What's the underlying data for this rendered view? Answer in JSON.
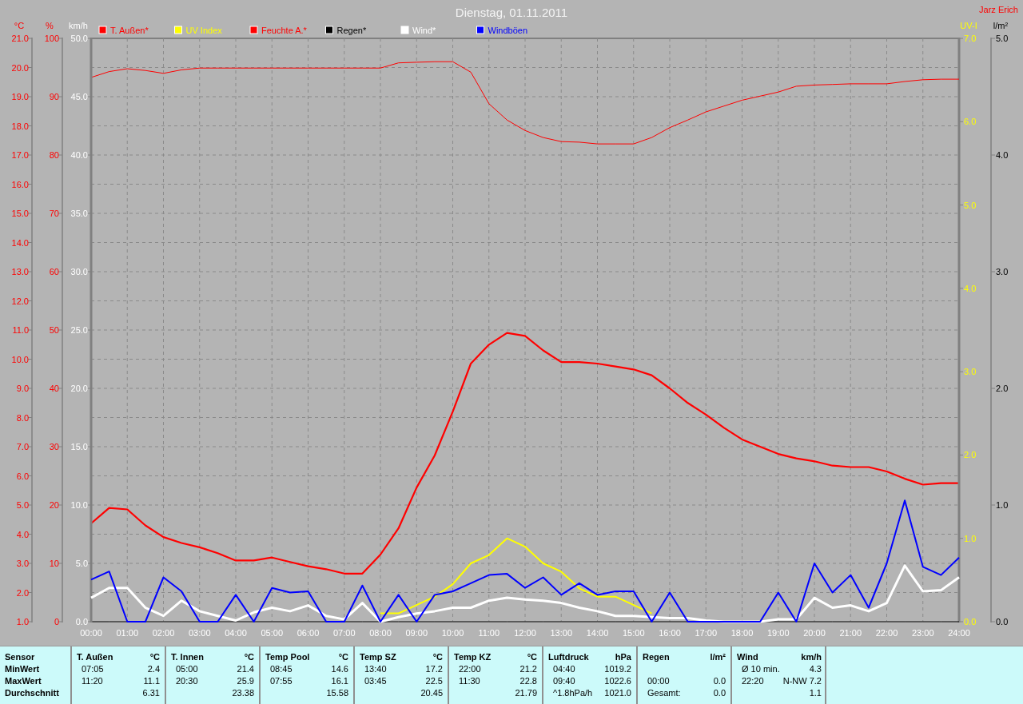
{
  "chart": {
    "title": "Dienstag, 01.11.2011",
    "author": "Jarz Erich",
    "layers": [
      {
        "chart_data": {
          "type": "line",
          "ylabel": "°C",
          "xlim": [
            0,
            24
          ],
          "ylim": [
            1,
            21
          ],
          "yticks": [
            {
              "value": 21,
              "label": "21.0"
            },
            {
              "value": 20,
              "label": "20.0"
            },
            {
              "value": 19,
              "label": "19.0"
            },
            {
              "value": 18,
              "label": "18.0"
            },
            {
              "value": 17,
              "label": "17.0"
            },
            {
              "value": 16,
              "label": "16.0"
            },
            {
              "value": 15,
              "label": "15.0"
            },
            {
              "value": 14,
              "label": "14.0"
            },
            {
              "value": 13,
              "label": "13.0"
            },
            {
              "value": 12,
              "label": "12.0"
            },
            {
              "value": 11,
              "label": "11.0"
            },
            {
              "value": 10,
              "label": "10.0"
            },
            {
              "value": 9,
              "label": "9.0"
            },
            {
              "value": 8,
              "label": "8.0"
            },
            {
              "value": 7,
              "label": "7.0"
            },
            {
              "value": 6,
              "label": "6.0"
            },
            {
              "value": 5,
              "label": "5.0"
            },
            {
              "value": 4,
              "label": "4.0"
            },
            {
              "value": 3,
              "label": "3.0"
            },
            {
              "value": 2,
              "label": "2.0"
            },
            {
              "value": 1,
              "label": "1.0"
            }
          ],
          "x": [
            0,
            0.5,
            1,
            1.5,
            2,
            2.5,
            3,
            3.5,
            4,
            4.5,
            5,
            5.5,
            6,
            6.5,
            7,
            7.5,
            8,
            8.5,
            9,
            9.5,
            10,
            10.5,
            11,
            11.5,
            12,
            12.5,
            13,
            13.5,
            14,
            14.5,
            15,
            15.5,
            16,
            16.5,
            17,
            17.5,
            18,
            18.5,
            19,
            19.5,
            20,
            20.5,
            21,
            21.5,
            22,
            22.5,
            23,
            23.5,
            24
          ],
          "series": [
            {
              "name": "T. Außen*",
              "color": "#ff0000",
              "values": [
                4.37,
                4.9,
                4.85,
                4.3,
                3.9,
                3.7,
                3.55,
                3.35,
                3.1,
                3.1,
                3.2,
                3.05,
                2.9,
                2.8,
                2.65,
                2.65,
                3.3,
                4.2,
                5.6,
                6.7,
                8.2,
                9.85,
                10.5,
                10.9,
                10.8,
                10.3,
                9.9,
                9.9,
                9.85,
                9.75,
                9.65,
                9.45,
                9.0,
                8.5,
                8.1,
                7.65,
                7.25,
                7.0,
                6.75,
                6.6,
                6.5,
                6.35,
                6.3,
                6.3,
                6.15,
                5.9,
                5.7,
                5.75,
                5.75
              ]
            }
          ]
        }
      },
      {
        "chart_data": {
          "type": "line",
          "ylabel": "UV-I",
          "xlim": [
            0,
            24
          ],
          "ylim": [
            0,
            7
          ],
          "yticks": [
            {
              "value": 7,
              "label": "7.0"
            },
            {
              "value": 6,
              "label": "6.0"
            },
            {
              "value": 5,
              "label": "5.0"
            },
            {
              "value": 4,
              "label": "4.0"
            },
            {
              "value": 3,
              "label": "3.0"
            },
            {
              "value": 2,
              "label": "2.0"
            },
            {
              "value": 1,
              "label": "1.0"
            },
            {
              "value": 0,
              "label": "0.0"
            }
          ],
          "x": [
            8,
            8.5,
            9,
            9.5,
            10,
            10.5,
            11,
            11.5,
            12,
            12.5,
            13,
            13.5,
            14,
            14.5,
            15,
            15.5
          ],
          "series": [
            {
              "name": "UV Index",
              "color": "#ffff00",
              "values": [
                0.1,
                0.1,
                0.2,
                0.3,
                0.45,
                0.7,
                0.8,
                1.0,
                0.9,
                0.7,
                0.6,
                0.4,
                0.3,
                0.3,
                0.2,
                0.1
              ]
            }
          ]
        }
      },
      {
        "chart_data": {
          "type": "line",
          "ylabel": "%",
          "xlim": [
            0,
            24
          ],
          "ylim": [
            0,
            100
          ],
          "yticks": [
            {
              "value": 100,
              "label": "100"
            },
            {
              "value": 90,
              "label": "90"
            },
            {
              "value": 80,
              "label": "80"
            },
            {
              "value": 70,
              "label": "70"
            },
            {
              "value": 60,
              "label": "60"
            },
            {
              "value": 50,
              "label": "50"
            },
            {
              "value": 40,
              "label": "40"
            },
            {
              "value": 30,
              "label": "30"
            },
            {
              "value": 20,
              "label": "20"
            },
            {
              "value": 10,
              "label": "10"
            },
            {
              "value": 0,
              "label": "0"
            }
          ],
          "x": [
            0,
            0.5,
            1,
            1.5,
            2,
            2.5,
            3,
            3.5,
            4,
            4.5,
            5,
            5.5,
            6,
            6.5,
            7,
            7.5,
            8,
            8.5,
            9,
            9.5,
            10,
            10.5,
            11,
            11.5,
            12,
            12.5,
            13,
            13.5,
            14,
            14.5,
            15,
            15.5,
            16,
            16.5,
            17,
            17.5,
            18,
            18.5,
            19,
            19.5,
            20,
            20.5,
            21,
            21.5,
            22,
            22.5,
            23,
            23.5,
            24
          ],
          "series": [
            {
              "name": "Feuchte A.*",
              "color": "#ff0000",
              "values": [
                93.3,
                94.3,
                94.8,
                94.5,
                94.0,
                94.6,
                94.9,
                94.9,
                94.9,
                94.9,
                94.9,
                94.9,
                94.9,
                94.9,
                94.9,
                94.9,
                94.9,
                95.8,
                95.9,
                96.0,
                96.0,
                94.2,
                88.8,
                86.0,
                84.2,
                83.0,
                82.3,
                82.2,
                81.9,
                81.9,
                81.9,
                83.0,
                84.7,
                86.0,
                87.4,
                88.4,
                89.4,
                90.1,
                90.8,
                91.8,
                92.0,
                92.1,
                92.2,
                92.2,
                92.2,
                92.6,
                92.9,
                93.0,
                93.0
              ]
            }
          ]
        }
      },
      {
        "chart_data": {
          "type": "line",
          "ylabel": "l/m²",
          "xlim": [
            0,
            24
          ],
          "ylim": [
            0,
            5
          ],
          "yticks": [
            {
              "value": 5,
              "label": "5.0"
            },
            {
              "value": 4,
              "label": "4.0"
            },
            {
              "value": 3,
              "label": "3.0"
            },
            {
              "value": 2,
              "label": "2.0"
            },
            {
              "value": 1,
              "label": "1.0"
            },
            {
              "value": 0,
              "label": "0.0"
            }
          ],
          "x": [
            0,
            0.5,
            1,
            1.5,
            2,
            2.5,
            3,
            3.5,
            4,
            4.5,
            5,
            5.5,
            6,
            6.5,
            7,
            7.5,
            8,
            8.5,
            9,
            9.5,
            10,
            10.5,
            11,
            11.5,
            12,
            12.5,
            13,
            13.5,
            14,
            14.5,
            15,
            15.5,
            16,
            16.5,
            17,
            17.5,
            18,
            18.5,
            19,
            19.5,
            20,
            20.5,
            21,
            21.5,
            22,
            22.5,
            23,
            23.5,
            24
          ],
          "series": [
            {
              "name": "Regen*",
              "color": "#000000",
              "values": [
                0,
                0,
                0,
                0,
                0,
                0,
                0,
                0,
                0,
                0,
                0,
                0,
                0,
                0,
                0,
                0,
                0,
                0,
                0,
                0,
                0,
                0,
                0,
                0,
                0,
                0,
                0,
                0,
                0,
                0,
                0,
                0,
                0,
                0,
                0,
                0,
                0,
                0,
                0,
                0,
                0,
                0,
                0,
                0,
                0,
                0,
                0,
                0,
                0
              ]
            }
          ]
        }
      },
      {
        "chart_data": {
          "type": "line",
          "ylabel": "km/h",
          "xlim": [
            0,
            24
          ],
          "ylim": [
            0,
            50
          ],
          "yticks": [
            {
              "value": 50,
              "label": "50.0"
            },
            {
              "value": 45,
              "label": "45.0"
            },
            {
              "value": 40,
              "label": "40.0"
            },
            {
              "value": 35,
              "label": "35.0"
            },
            {
              "value": 30,
              "label": "30.0"
            },
            {
              "value": 25,
              "label": "25.0"
            },
            {
              "value": 20,
              "label": "20.0"
            },
            {
              "value": 15,
              "label": "15.0"
            },
            {
              "value": 10,
              "label": "10.0"
            },
            {
              "value": 5,
              "label": "5.0"
            },
            {
              "value": 0,
              "label": "0.0"
            }
          ],
          "xticks": [
            {
              "value": 0,
              "label": "00:00"
            },
            {
              "value": 1,
              "label": "01:00"
            },
            {
              "value": 2,
              "label": "02:00"
            },
            {
              "value": 3,
              "label": "03:00"
            },
            {
              "value": 4,
              "label": "04:00"
            },
            {
              "value": 5,
              "label": "05:00"
            },
            {
              "value": 6,
              "label": "06:00"
            },
            {
              "value": 7,
              "label": "07:00"
            },
            {
              "value": 8,
              "label": "08:00"
            },
            {
              "value": 9,
              "label": "09:00"
            },
            {
              "value": 10,
              "label": "10:00"
            },
            {
              "value": 11,
              "label": "11:00"
            },
            {
              "value": 12,
              "label": "12:00"
            },
            {
              "value": 13,
              "label": "13:00"
            },
            {
              "value": 14,
              "label": "14:00"
            },
            {
              "value": 15,
              "label": "15:00"
            },
            {
              "value": 16,
              "label": "16:00"
            },
            {
              "value": 17,
              "label": "17:00"
            },
            {
              "value": 18,
              "label": "18:00"
            },
            {
              "value": 19,
              "label": "19:00"
            },
            {
              "value": 20,
              "label": "20:00"
            },
            {
              "value": 21,
              "label": "21:00"
            },
            {
              "value": 22,
              "label": "22:00"
            },
            {
              "value": 23,
              "label": "23:00"
            },
            {
              "value": 24,
              "label": "24:00"
            }
          ],
          "x": [
            0,
            0.5,
            1,
            1.5,
            2,
            2.5,
            3,
            3.5,
            4,
            4.5,
            5,
            5.5,
            6,
            6.5,
            7,
            7.5,
            8,
            8.5,
            9,
            9.5,
            10,
            10.5,
            11,
            11.5,
            12,
            12.5,
            13,
            13.5,
            14,
            14.5,
            15,
            15.5,
            16,
            16.5,
            17,
            17.5,
            18,
            18.5,
            19,
            19.5,
            20,
            20.5,
            21,
            21.5,
            22,
            22.5,
            23,
            23.5,
            24
          ],
          "series": [
            {
              "name": "Wind*",
              "color": "#ffffff",
              "values": [
                2.05,
                2.9,
                2.9,
                1.2,
                0.5,
                1.8,
                0.9,
                0.5,
                0.1,
                0.8,
                1.2,
                0.9,
                1.4,
                0.5,
                0.2,
                1.6,
                0,
                0.4,
                0.7,
                0.9,
                1.2,
                1.2,
                1.8,
                2.05,
                1.9,
                1.8,
                1.6,
                1.2,
                0.9,
                0.5,
                0.5,
                0.4,
                0.3,
                0.3,
                0.1,
                0,
                0,
                0,
                0.2,
                0.2,
                2.05,
                1.2,
                1.4,
                0.9,
                1.6,
                4.8,
                2.6,
                2.7,
                3.8
              ]
            },
            {
              "name": "Windböen",
              "color": "#0000ff",
              "values": [
                3.6,
                4.3,
                0,
                0,
                3.8,
                2.6,
                0,
                0,
                2.3,
                0,
                2.9,
                2.5,
                2.6,
                0,
                0,
                3.1,
                0,
                2.3,
                0,
                2.3,
                2.6,
                3.3,
                4.0,
                4.1,
                2.9,
                3.8,
                2.3,
                3.3,
                2.3,
                2.6,
                2.6,
                0,
                2.5,
                0,
                0,
                0,
                0,
                0,
                2.5,
                0,
                5.0,
                2.5,
                4.0,
                1.2,
                5.0,
                10.4,
                4.7,
                4.0,
                5.5
              ]
            }
          ]
        }
      }
    ]
  },
  "table": {
    "row_labels": [
      "Sensor",
      "MinWert",
      "MaxWert",
      "Durchschnitt"
    ],
    "columns": [
      {
        "header": "T. Außen",
        "unit": "°C",
        "rows": [
          {
            "label": "07:05",
            "value": "2.4"
          },
          {
            "label": "11:20",
            "value": "11.1"
          },
          {
            "value": "6.31"
          }
        ]
      },
      {
        "header": "T. Innen",
        "unit": "°C",
        "rows": [
          {
            "label": "05:00",
            "value": "21.4"
          },
          {
            "label": "20:30",
            "value": "25.9"
          },
          {
            "value": "23.38"
          }
        ]
      },
      {
        "header": "Temp Pool",
        "unit": "°C",
        "rows": [
          {
            "label": "08:45",
            "value": "14.6"
          },
          {
            "label": "07:55",
            "value": "16.1"
          },
          {
            "value": "15.58"
          }
        ]
      },
      {
        "header": "Temp SZ",
        "unit": "°C",
        "rows": [
          {
            "label": "13:40",
            "value": "17.2"
          },
          {
            "label": "03:45",
            "value": "22.5"
          },
          {
            "value": "20.45"
          }
        ]
      },
      {
        "header": "Temp KZ",
        "unit": "°C",
        "rows": [
          {
            "label": "22:00",
            "value": "21.2"
          },
          {
            "label": "11:30",
            "value": "22.8"
          },
          {
            "value": "21.79"
          }
        ]
      },
      {
        "header": "Luftdruck",
        "unit": "hPa",
        "rows": [
          {
            "label": "04:40",
            "value": "1019.2"
          },
          {
            "label": "09:40",
            "value": "1022.6"
          },
          {
            "label": "^1.8hPa/h",
            "value": "1021.0"
          }
        ]
      },
      {
        "header": "Regen",
        "unit": "l/m²",
        "rows": [
          null,
          {
            "label": "00:00",
            "value": "0.0"
          },
          {
            "label": "Gesamt:",
            "value": "0.0"
          }
        ]
      },
      {
        "header": "Wind",
        "unit": "km/h",
        "rows": [
          {
            "label": "Ø 10 min.",
            "value": "4.3"
          },
          {
            "label": "22:20",
            "value": "N-NW 7.2"
          },
          {
            "value": "1.1"
          }
        ]
      }
    ]
  }
}
